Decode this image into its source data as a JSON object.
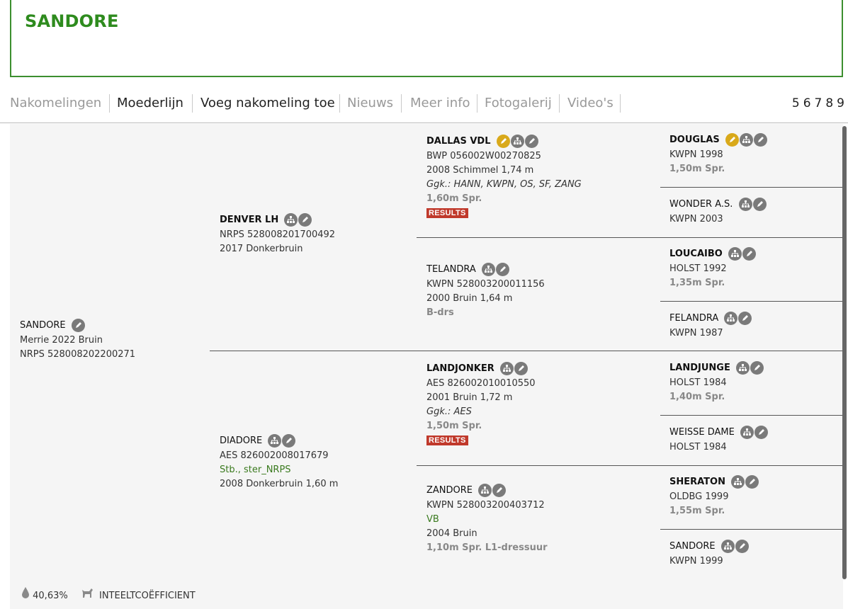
{
  "page_title": "SANDORE",
  "tabs": [
    {
      "label": "Nakomelingen",
      "active": false
    },
    {
      "label": "Moederlijn",
      "active": true
    },
    {
      "label": "Voeg nakomeling toe",
      "active": true
    },
    {
      "label": "Nieuws",
      "active": false
    },
    {
      "label": "Meer info",
      "active": false
    },
    {
      "label": "Fotogalerij",
      "active": false
    },
    {
      "label": "Video's",
      "active": false
    }
  ],
  "page_numbers": "56789",
  "results_label": "RESULTS",
  "subject": {
    "name": "SANDORE",
    "line1": "Merrie 2022 Bruin",
    "line2": "NRPS 528008202200271"
  },
  "sire": {
    "name": "DENVER LH",
    "line1": "NRPS 528008201700492",
    "line2": "2017 Donkerbruin"
  },
  "dam": {
    "name": "DIADORE",
    "line1": "AES 826002008017679",
    "line2": "Stb., ster_NRPS",
    "line3": "2008 Donkerbruin 1,60 m"
  },
  "grandparents": {
    "ss": {
      "name": "DALLAS VDL",
      "line1": "BWP 056002W00270825",
      "line2": "2008 Schimmel 1,74 m",
      "line3": "Ggk.: HANN, KWPN, OS, SF, ZANG",
      "line4": "1,60m Spr."
    },
    "sd": {
      "name": "TELANDRA",
      "line1": "KWPN 528003200011156",
      "line2": "2000 Bruin 1,64 m",
      "line3": "B-drs"
    },
    "ds": {
      "name": "LANDJONKER",
      "line1": "AES 826002010010550",
      "line2": "2001 Bruin 1,72 m",
      "line3": "Ggk.: AES",
      "line4": "1,50m Spr."
    },
    "dd": {
      "name": "ZANDORE",
      "line1": "KWPN 528003200403712",
      "line2": "VB",
      "line3": "2004 Bruin",
      "line4": "1,10m Spr. L1-dressuur"
    }
  },
  "great_grandparents": [
    {
      "name": "DOUGLAS",
      "line1": "KWPN 1998",
      "line2": "1,50m Spr."
    },
    {
      "name": "WONDER A.S.",
      "line1": "KWPN 2003",
      "line2": ""
    },
    {
      "name": "LOUCAIBO",
      "line1": "HOLST 1992",
      "line2": "1,35m Spr."
    },
    {
      "name": "FELANDRA",
      "line1": "KWPN 1987",
      "line2": ""
    },
    {
      "name": "LANDJUNGE",
      "line1": "HOLST 1984",
      "line2": "1,40m Spr."
    },
    {
      "name": "WEISSE DAME",
      "line1": "HOLST 1984",
      "line2": ""
    },
    {
      "name": "SHERATON",
      "line1": "OLDBG 1999",
      "line2": "1,55m Spr."
    },
    {
      "name": "SANDORE",
      "line1": "KWPN 1999",
      "line2": ""
    }
  ],
  "footer": {
    "percentage": "40,63%",
    "label": "INTEELTCOËFFICIENT"
  },
  "colors": {
    "brand_green": "#2e8b1e",
    "results_red": "#c0392b",
    "gold_icon": "#d9a91a",
    "grey_icon": "#7a7a7a"
  }
}
